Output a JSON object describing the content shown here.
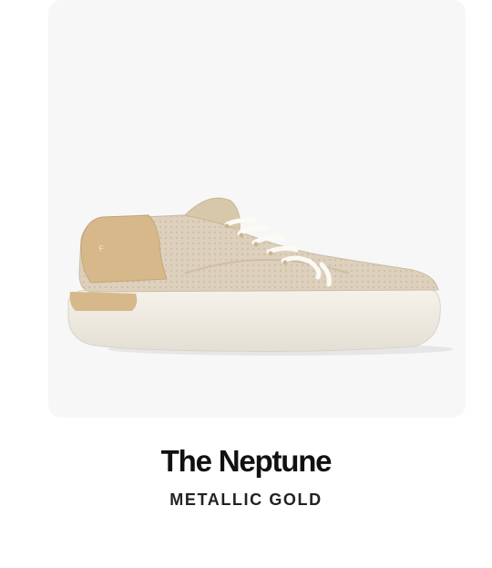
{
  "product": {
    "name": "The Neptune",
    "colorway": "METALLIC GOLD",
    "image_subject": "sneaker-side-view",
    "colors": {
      "image_background": "#f7f7f8",
      "upper_knit": "#ddd0bc",
      "heel_suede": "#d6b88a",
      "sole": "#f3f0e8",
      "laces": "#fbfaf5"
    }
  }
}
